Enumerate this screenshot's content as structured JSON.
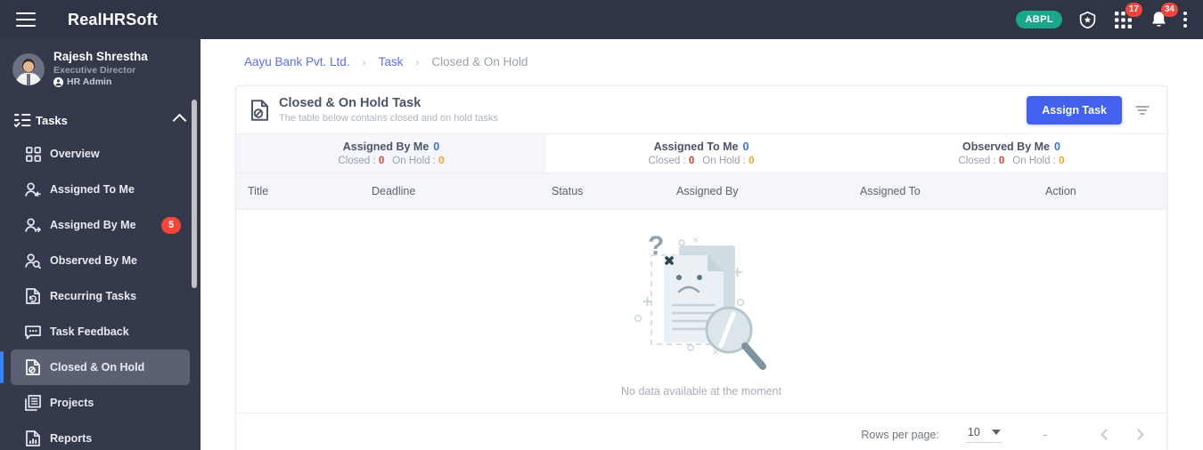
{
  "topbar": {
    "menu_icon": "hamburger-icon",
    "brand": "RealHRSoft",
    "org_pill": "ABPL",
    "shield_icon": "shield-star-icon",
    "apps_icon": "grid-apps-icon",
    "apps_badge": "17",
    "bell_icon": "bell-icon",
    "bell_badge": "34",
    "more_icon": "vertical-dots-icon"
  },
  "profile": {
    "name": "Rajesh Shrestha",
    "role": "Executive Director",
    "admin_label": "HR Admin",
    "admin_icon": "user-circle-icon",
    "avatar_name": "avatar"
  },
  "sidebar": {
    "section": {
      "label": "Tasks",
      "icon": "tasks-list-icon",
      "chevron": "chevron-up-icon"
    },
    "items": [
      {
        "label": "Overview",
        "icon": "grid-overview-icon",
        "badge": "",
        "active": false
      },
      {
        "label": "Assigned To Me",
        "icon": "user-arrow-in-icon",
        "badge": "",
        "active": false
      },
      {
        "label": "Assigned By Me",
        "icon": "user-arrow-out-icon",
        "badge": "5",
        "active": false
      },
      {
        "label": "Observed By Me",
        "icon": "user-search-icon",
        "badge": "",
        "active": false
      },
      {
        "label": "Recurring Tasks",
        "icon": "file-refresh-icon",
        "badge": "",
        "active": false
      },
      {
        "label": "Task Feedback",
        "icon": "chat-dots-icon",
        "badge": "",
        "active": false
      },
      {
        "label": "Closed & On Hold",
        "icon": "file-blocked-icon",
        "badge": "",
        "active": true
      },
      {
        "label": "Projects",
        "icon": "documents-stack-icon",
        "badge": "",
        "active": false
      },
      {
        "label": "Reports",
        "icon": "file-chart-icon",
        "badge": "",
        "active": false
      }
    ]
  },
  "breadcrumb": {
    "items": [
      {
        "label": "Aayu Bank Pvt. Ltd.",
        "current": false
      },
      {
        "label": "Task",
        "current": false
      },
      {
        "label": "Closed & On Hold",
        "current": true
      }
    ],
    "separator": "›"
  },
  "card": {
    "icon": "file-blocked-icon",
    "title": "Closed & On Hold Task",
    "subtitle": "The table below contains closed and on hold tasks",
    "assign_button": "Assign Task",
    "filter_icon": "filter-icon"
  },
  "stats": [
    {
      "label": "Assigned By Me",
      "count": "0",
      "closed_label": "Closed :",
      "closed": "0",
      "onhold_label": "On Hold :",
      "onhold": "0",
      "highlighted": true
    },
    {
      "label": "Assigned To Me",
      "count": "0",
      "closed_label": "Closed :",
      "closed": "0",
      "onhold_label": "On Hold :",
      "onhold": "0",
      "highlighted": false
    },
    {
      "label": "Observed By Me",
      "count": "0",
      "closed_label": "Closed :",
      "closed": "0",
      "onhold_label": "On Hold :",
      "onhold": "0",
      "highlighted": false
    }
  ],
  "table": {
    "columns": [
      "Title",
      "Deadline",
      "Status",
      "Assigned By",
      "Assigned To",
      "Action"
    ],
    "rows": [],
    "empty_message": "No data available at the moment",
    "empty_illustration": "no-data-document-magnifier-illustration"
  },
  "pagination": {
    "rows_per_page_label": "Rows per page:",
    "rows_per_page_value": "10",
    "range_label": "-",
    "prev_icon": "chevron-left-icon",
    "next_icon": "chevron-right-icon",
    "caret_icon": "caret-down-icon"
  },
  "colors": {
    "topbar_bg": "#2f3446",
    "sidebar_bg": "#343a4c",
    "active_item_bg": "#5b6073",
    "active_accent": "#3b82f6",
    "primary_button": "#4361ee",
    "link": "#5b6ef2",
    "badge_red": "#f4453a",
    "closed_red": "#e8402a",
    "onhold_orange": "#f5a623",
    "count_blue": "#3b6ef2",
    "org_pill_green": "#19a88c",
    "stat_highlight_bg": "#f5f6fb",
    "table_header_bg": "#f4f6fa"
  }
}
